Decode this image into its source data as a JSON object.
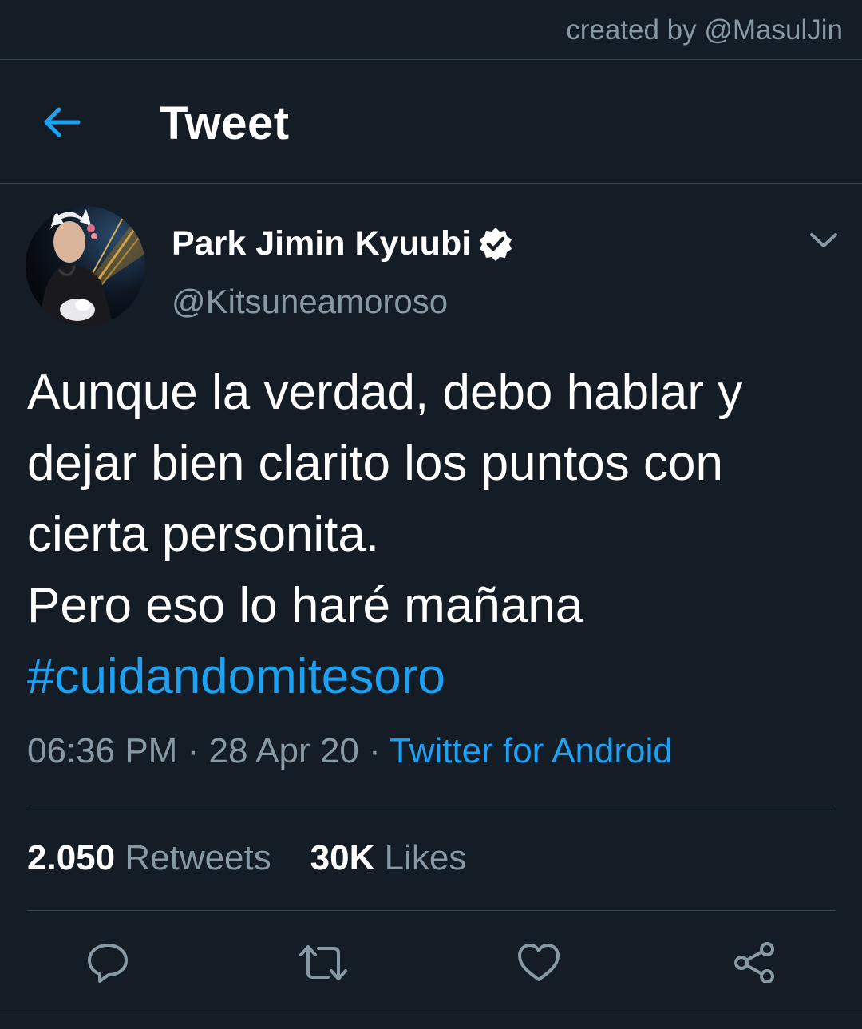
{
  "watermark": "created by @MasulJin",
  "header": {
    "back_icon": "arrow-left-icon",
    "title": "Tweet"
  },
  "tweet": {
    "display_name": "Park Jimin Kyuubi",
    "verified_icon": "verified-badge-icon",
    "handle": "@Kitsuneamoroso",
    "menu_icon": "chevron-down-icon",
    "lines": [
      "Aunque la verdad, debo hablar y",
      "dejar bien clarito los puntos con",
      "cierta personita.",
      "Pero eso lo haré mañana"
    ],
    "hashtag": "#cuidandomitesoro",
    "time": "06:36 PM",
    "separator": "·",
    "date": "28 Apr 20",
    "source": "Twitter for Android",
    "retweets_count": "2.050",
    "retweets_label": "Retweets",
    "likes_count": "30K",
    "likes_label": "Likes"
  },
  "actions": [
    "reply-icon",
    "retweet-icon",
    "like-icon",
    "share-icon"
  ],
  "colors": {
    "background": "#141d26",
    "divider": "#38444d",
    "accent": "#1da1f2",
    "secondary_text": "#8899a6",
    "primary_text": "#ffffff"
  }
}
